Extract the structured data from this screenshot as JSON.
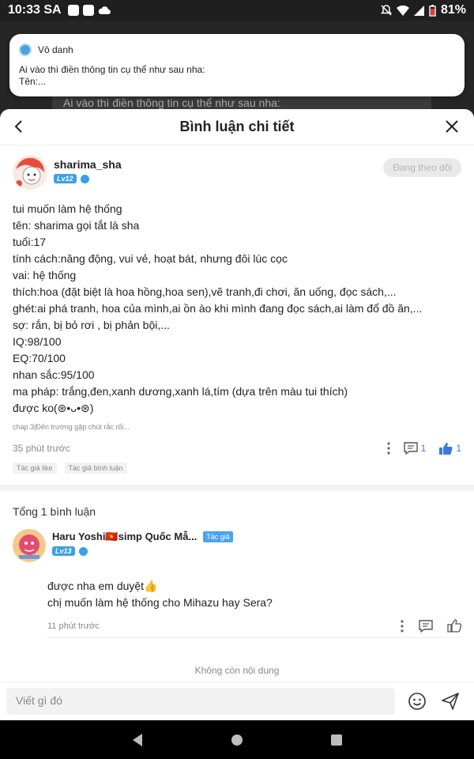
{
  "status_bar": {
    "time": "10:33 SA",
    "battery": "81%"
  },
  "background": {
    "comment_preview": "Ai vào thì điền thông tin cụ thể như sau nha:"
  },
  "notification": {
    "app_name": "Vô danh",
    "lines": [
      "Ai vào thì điền thông tin cụ thể như sau nha:",
      "Tên:..."
    ]
  },
  "header": {
    "title": "Bình luận chi tiết"
  },
  "post": {
    "username": "sharima_sha",
    "level": "Lv12",
    "follow_label": "Đang theo dõi",
    "lines": [
      "tui muốn làm hệ thống",
      "tên: sharima gọi tắt là sha",
      "tuổi:17",
      "tính cách:năng động, vui vẻ, hoạt bát, nhưng đôi lúc cọc",
      "vai: hệ thống",
      "thích:hoa (đặt biệt là hoa hồng,hoa sen),vẽ tranh,đi chơi, ăn uống, đọc sách,...",
      "ghét:ai phá tranh, hoa của mình,ai ồn ào khi mình đang đọc sách,ai làm đổ đồ ăn,...",
      "sợ: rắn, bị bỏ rơi , bị phản bội,...",
      "IQ:98/100",
      "EQ:70/100",
      "nhan sắc:95/100",
      "ma pháp: trắng,đen,xanh dương,xanh lá,tím (dựa trên màu tui thích)",
      "được ko(⊛•ᴗ•⊛)"
    ],
    "chapter": "chap 3|Đến trường gặp chút rắc rối...",
    "time": "35 phút trước",
    "comment_count": "1",
    "like_count": "1",
    "tags": [
      "Tác giả like",
      "Tác giả bình luận"
    ]
  },
  "comments": {
    "total_label": "Tổng 1 bình luận",
    "items": [
      {
        "name": "Haru Yoshi🇻🇳simp Quốc Mẫ...",
        "author_tag": "Tác giả",
        "level": "Lv13",
        "lines": [
          "được nha em duyệt👍",
          "chị muốn làm hệ thống cho Mihazu hay Sera?"
        ],
        "time": "11 phút trước"
      }
    ],
    "no_more": "Không còn nội dung"
  },
  "input": {
    "placeholder": "Viết gì đó"
  },
  "colors": {
    "accent": "#3a7bd5",
    "badge": "#3aa0e8",
    "author_tag": "#4aa3ef"
  }
}
